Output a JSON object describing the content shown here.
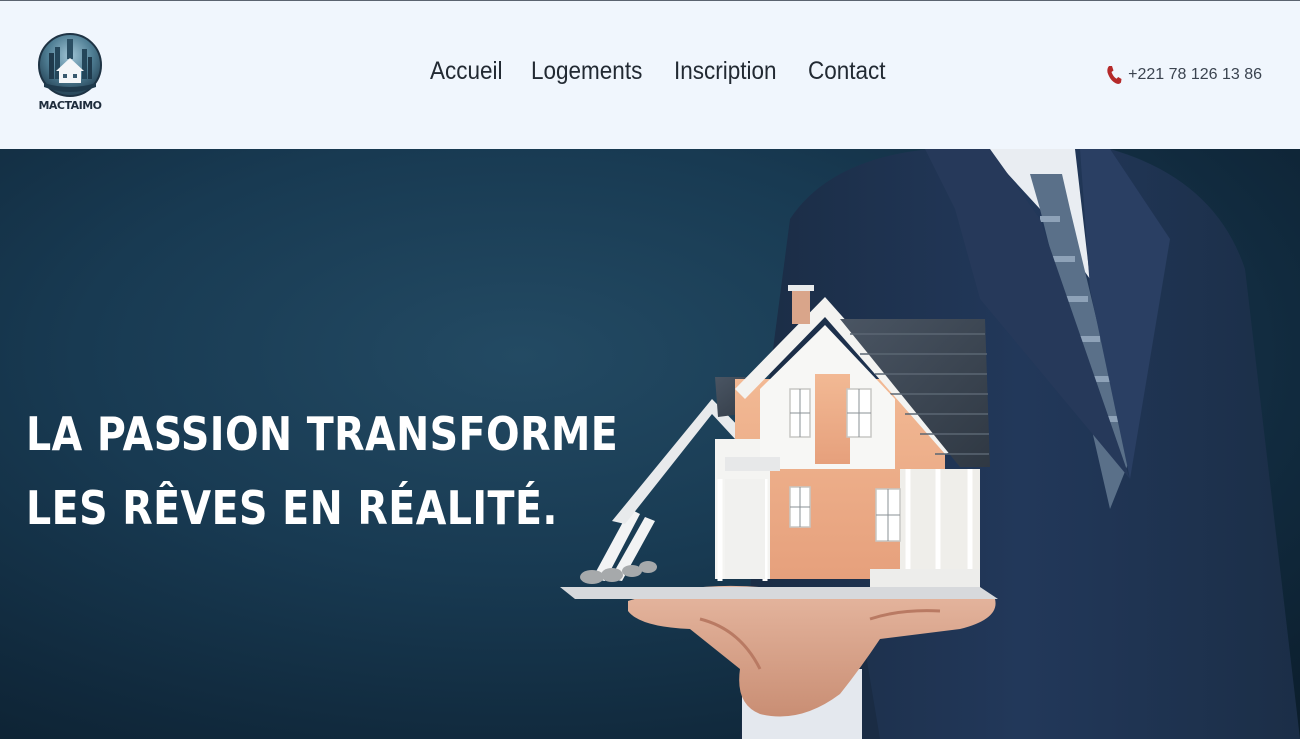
{
  "brand": {
    "logo_text": "MACTAIMO",
    "logo_icon": "city-house-logo"
  },
  "nav": {
    "items": [
      {
        "label": "Accueil"
      },
      {
        "label": "Logements"
      },
      {
        "label": "Inscription"
      },
      {
        "label": "Contact"
      }
    ]
  },
  "contact": {
    "phone_icon": "phone-icon",
    "phone": "+221 78 126 13 86"
  },
  "hero": {
    "title_line1": "LA PASSION TRANSFORME",
    "title_line2": "LES RÊVES EN RÉALITÉ.",
    "image": "businessman-holding-house-model"
  },
  "colors": {
    "header_bg": "#f0f6fd",
    "hero_bg": "#173850",
    "accent_phone": "#b52a2a",
    "title_text": "#ffffff"
  }
}
